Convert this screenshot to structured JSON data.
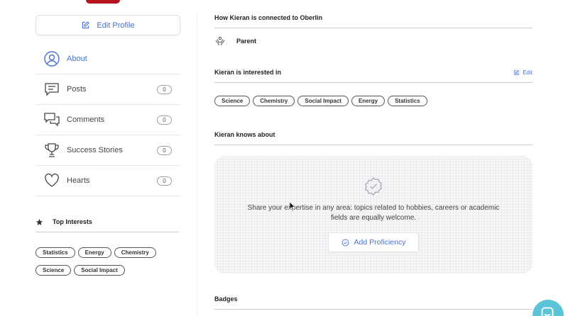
{
  "sidebar": {
    "edit_profile_label": "Edit Profile",
    "nav": [
      {
        "label": "About",
        "icon": "user-circle-icon",
        "active": true
      },
      {
        "label": "Posts",
        "icon": "message-square-icon",
        "count": "0"
      },
      {
        "label": "Comments",
        "icon": "messages-icon",
        "count": "0"
      },
      {
        "label": "Success Stories",
        "icon": "trophy-icon",
        "count": "0"
      },
      {
        "label": "Hearts",
        "icon": "heart-icon",
        "count": "0"
      }
    ],
    "top_interests_title": "Top Interests",
    "top_interests": [
      "Statistics",
      "Energy",
      "Chemistry",
      "Science",
      "Social Impact"
    ]
  },
  "main": {
    "connection_title": "How Kieran is connected to Oberlin",
    "connection_value": "Parent",
    "interests_title": "Kieran is interested in",
    "edit_label": "Edit",
    "interests": [
      "Science",
      "Chemistry",
      "Social Impact",
      "Energy",
      "Statistics"
    ],
    "knows_title": "Kieran knows about",
    "knows_text": "Share your expertise in any area: topics related to hobbies, careers or academic fields are equally welcome.",
    "add_proficiency_label": "Add Proficiency",
    "badges_title": "Badges"
  },
  "colors": {
    "accent": "#4a6fd0",
    "brand_red": "#b5121b",
    "chat": "#5bc4d6"
  }
}
